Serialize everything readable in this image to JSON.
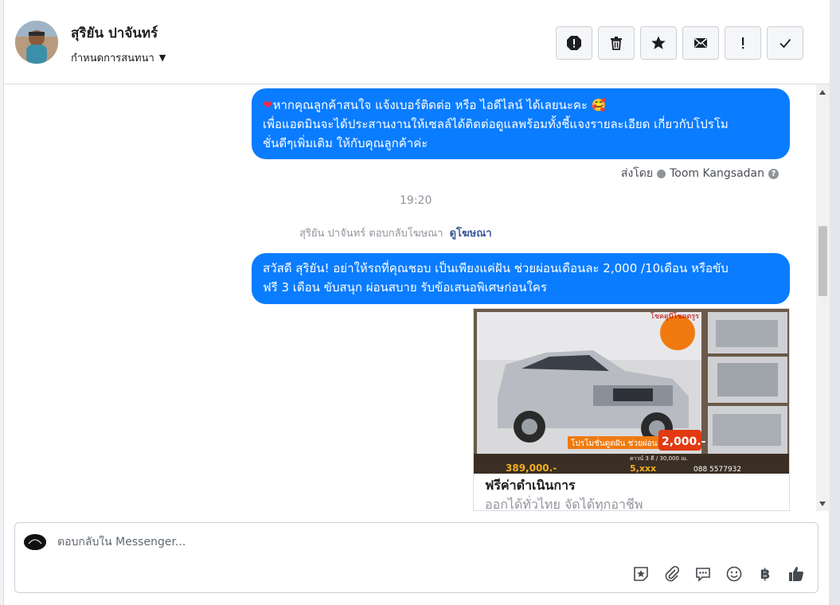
{
  "header": {
    "name": "สุริยัน ปาจันทร์",
    "subtitle": "กำหนดการสนทนา",
    "tools": [
      {
        "name": "report-icon"
      },
      {
        "name": "trash-icon"
      },
      {
        "name": "star-icon"
      },
      {
        "name": "envelope-icon"
      },
      {
        "name": "exclamation-icon"
      },
      {
        "name": "check-icon"
      }
    ]
  },
  "messages": {
    "first": {
      "line1": "หากคุณลูกค้าสนใจ แจ้งเบอร์ติดต่อ หรือ ไอดีไลน์ ได้เลยนะคะ 🥰",
      "line2": "เพื่อแอดมินจะได้ประสานงานให้เซลล์ได้ติดต่อดูแลพร้อมทั้งชี้แจงรายละเอียด เกี่ยวกับโปรโม",
      "line3": "ชั่นดีๆเพิ่มเติม ให้กับคุณลูกค้าค่ะ"
    },
    "sent_by_label": "ส่งโดย",
    "sent_by_name": "Toom Kangsadan",
    "time": "19:20",
    "ad_reply_text": "สุริยัน ปาจันทร์ ตอบกลับโฆษณา",
    "ad_reply_link": "ดูโฆษณา",
    "second": {
      "line1": "สวัสดี สุริยัน! อย่าให้รถที่คุณชอบ เป็นเพียงแค่ฝัน ช่วยผ่อนเดือนละ 2,000 /10เดือน หรือขับ",
      "line2": "ฟรี 3 เดือน ขับสนุก ผ่อนสบาย รับข้อเสนอพิเศษก่อนใคร"
    }
  },
  "ad_card": {
    "title": "ฟรีค่าดำเนินการ",
    "subtitle": "ออกได้ทั่วไทย จัดได้ทุกอาชีพ",
    "badge_price": "2,000.-",
    "promo_text": "โปรโมชั่นดูดฝัน ช่วยผ่อน",
    "price_text": "389,000.-",
    "phone_text": "088 5577932",
    "top_banner": "โชคดูบีโชคตรูร",
    "bottom_mid": "5,xxx",
    "down_text": "ดาวน์ 3 ดี / 30,000 ณ."
  },
  "composer": {
    "placeholder": "ตอบกลับใน Messenger...",
    "icons": [
      "sticker-icon",
      "paperclip-icon",
      "saved-replies-icon",
      "emoji-icon",
      "baht-icon",
      "thumbs-up-icon"
    ],
    "baht_symbol": "฿"
  },
  "colors": {
    "bubble": "#0a7cff",
    "link": "#385898",
    "muted": "#90949c"
  }
}
